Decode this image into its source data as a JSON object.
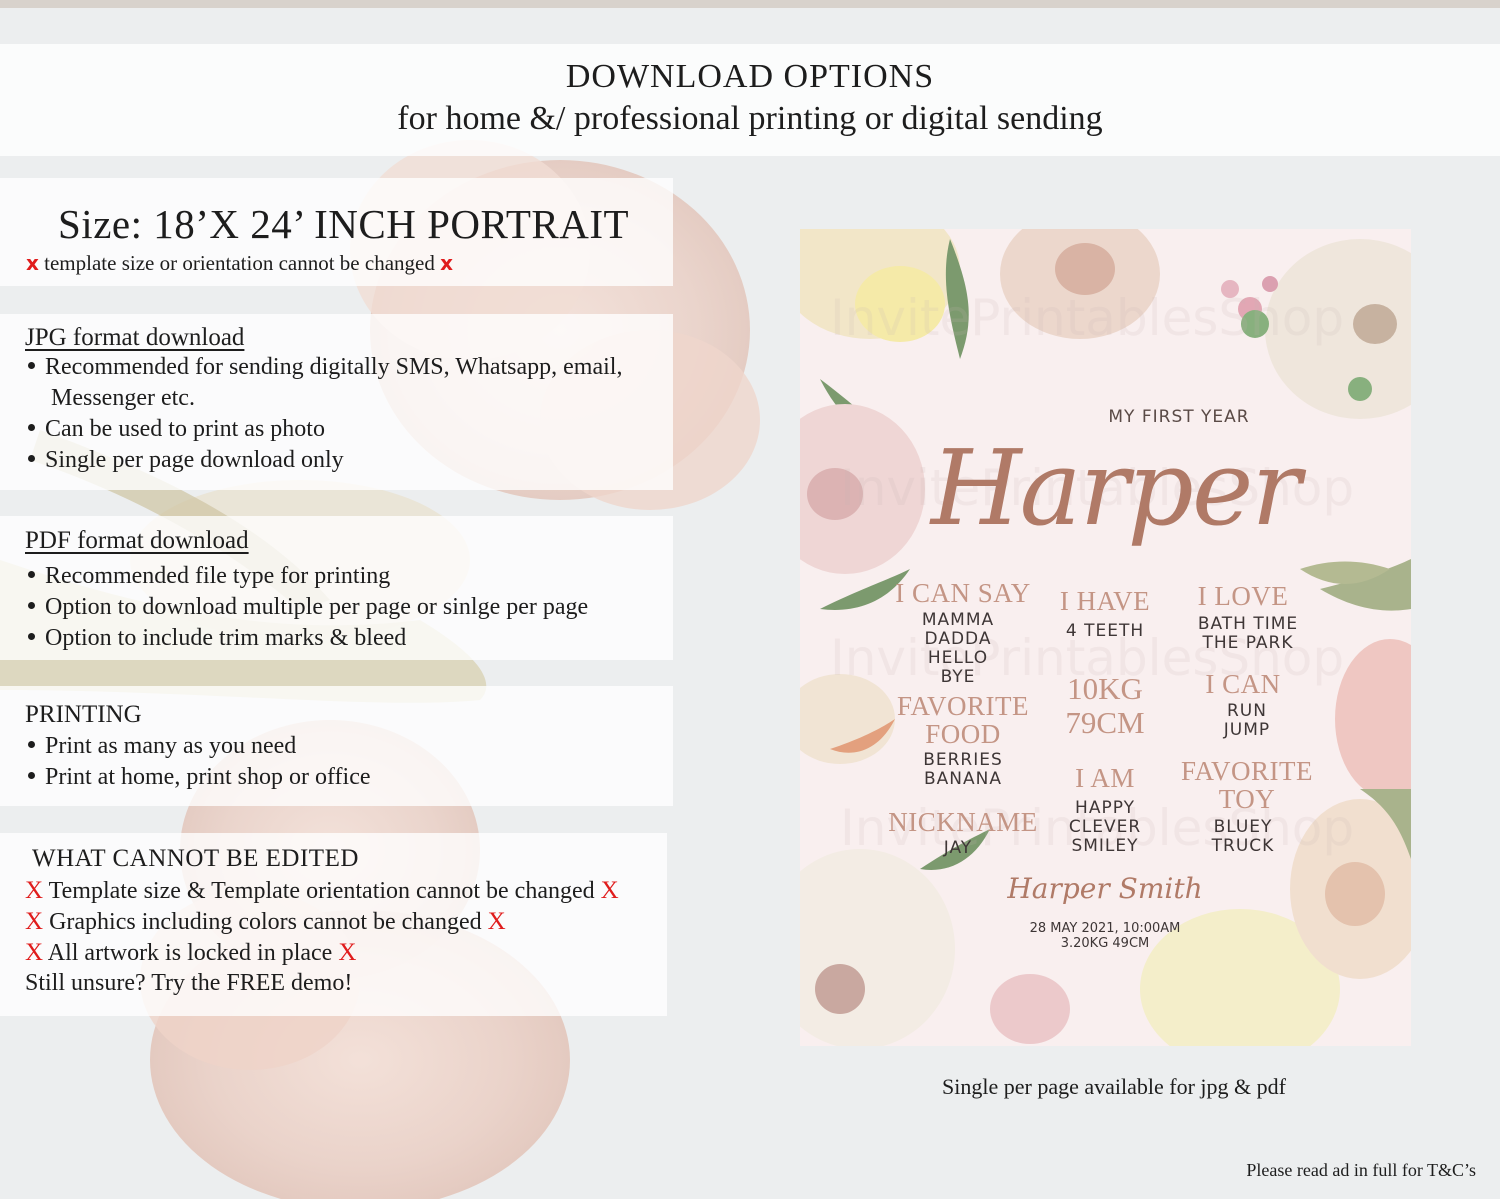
{
  "header": {
    "title": "DOWNLOAD OPTIONS",
    "subtitle": "for home &/ professional printing or digital sending"
  },
  "size": {
    "title": "Size: 18’X 24’ INCH PORTRAIT",
    "mark": "x",
    "note": "template size or orientation cannot be changed"
  },
  "jpg": {
    "title": "JPG format download",
    "items": [
      "Recommended for sending digitally SMS, Whatsapp, email,",
      "Can be used to print as photo",
      "Single per page download only"
    ],
    "item1_cont": "Messenger etc."
  },
  "pdf": {
    "title": "PDF format download",
    "items": [
      "Recommended file type for printing",
      "Option to download multiple per page or sinlge per page",
      "Option to include trim marks & bleed"
    ]
  },
  "printing": {
    "title": "PRINTING",
    "items": [
      "Print as many as you need",
      "Print at home, print shop or office"
    ]
  },
  "edit": {
    "title": "WHAT CANNOT BE EDITED",
    "mark": "X",
    "items": [
      "Template size & Template orientation cannot be changed",
      "Graphics including colors cannot be changed",
      "All artwork is locked in place"
    ],
    "closing": "Still unsure? Try the FREE demo!"
  },
  "poster": {
    "top_line": "MY FIRST YEAR",
    "name": "Harper",
    "watermark": "InvitePrintablesShop",
    "i_can_say": {
      "title": "I CAN SAY",
      "values": [
        "MAMMA",
        "DADDA",
        "HELLO",
        "BYE"
      ]
    },
    "i_have": {
      "title": "I HAVE",
      "values": [
        "4 TEETH"
      ]
    },
    "i_love": {
      "title": "I LOVE",
      "values": [
        "BATH TIME",
        "THE PARK"
      ]
    },
    "weight": "10KG",
    "height": "79CM",
    "i_can": {
      "title": "I CAN",
      "values": [
        "RUN",
        "JUMP"
      ]
    },
    "favorite_food": {
      "title_1": "FAVORITE",
      "title_2": "FOOD",
      "values": [
        "BERRIES",
        "BANANA"
      ]
    },
    "i_am": {
      "title": "I AM",
      "values": [
        "HAPPY",
        "CLEVER",
        "SMILEY"
      ]
    },
    "favorite_toy": {
      "title_1": "FAVORITE",
      "title_2": "TOY",
      "values": [
        "BLUEY",
        "TRUCK"
      ]
    },
    "nickname": {
      "title": "NICKNAME",
      "values": [
        "JAY"
      ]
    },
    "signature": "Harper Smith",
    "birth_line_1": "28 MAY 2021, 10:00AM",
    "birth_line_2": "3.20KG 49CM"
  },
  "caption": "Single per page available for jpg & pdf",
  "footnote": "Please read ad in full for T&C’s",
  "colors": {
    "accent_red": "#e01c1c",
    "rose_gold": "#b07a67",
    "poster_bg": "#f9efef"
  }
}
